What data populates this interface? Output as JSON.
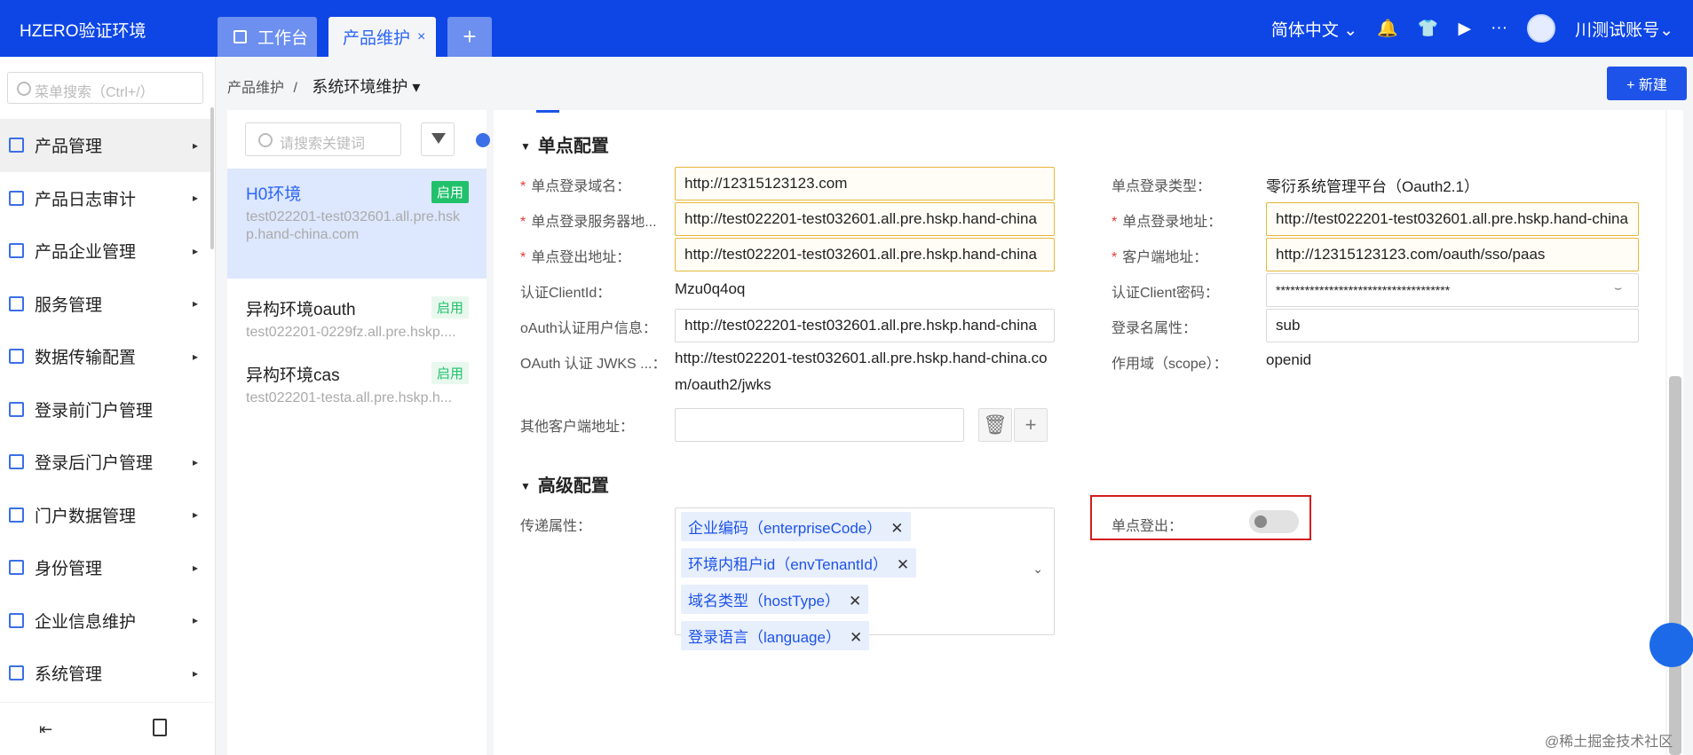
{
  "app": {
    "brand": "HZERO验证环境"
  },
  "tabs": {
    "workspace": "工作台",
    "product": "产品维护",
    "close": "×",
    "add": "+"
  },
  "topbar": {
    "language": "简体中文 ⌄",
    "user": "川测试账号⌄"
  },
  "sidebar": {
    "search_placeholder": "菜单搜索（Ctrl+/）",
    "items": [
      {
        "label": "产品管理",
        "arrow": "▸"
      },
      {
        "label": "产品日志审计",
        "arrow": "▸"
      },
      {
        "label": "产品企业管理",
        "arrow": "▸"
      },
      {
        "label": "服务管理",
        "arrow": "▸"
      },
      {
        "label": "数据传输配置",
        "arrow": "▸"
      },
      {
        "label": "登录前门户管理",
        "arrow": ""
      },
      {
        "label": "登录后门户管理",
        "arrow": "▸"
      },
      {
        "label": "门户数据管理",
        "arrow": "▸"
      },
      {
        "label": "身份管理",
        "arrow": "▸"
      },
      {
        "label": "企业信息维护",
        "arrow": "▸"
      },
      {
        "label": "系统管理",
        "arrow": "▸"
      }
    ],
    "footer_collapse": "⇤"
  },
  "breadcrumb": {
    "parent": "产品维护",
    "sep": "/",
    "current": "系统环境维护 ▾"
  },
  "new_button": "+ 新建",
  "list": {
    "search_placeholder": "请搜索关键词",
    "items": [
      {
        "name": "H0环境",
        "sub": "test022201-test032601.all.pre.hskp.hand-china.com",
        "badge": "启用"
      },
      {
        "name": "异构环境oauth",
        "sub": "test022201-0229fz.all.pre.hskp....",
        "badge": "启用"
      },
      {
        "name": "异构环境cas",
        "sub": "test022201-testa.all.pre.hskp.h...",
        "badge": "启用"
      }
    ]
  },
  "sso": {
    "section": "单点配置",
    "domain_label": "单点登录域名：",
    "domain_value": "http://12315123123.com",
    "type_label": "单点登录类型：",
    "type_value": "零衍系统管理平台（Oauth2.1）",
    "server_label": "单点登录服务器地...",
    "server_value": "http://test022201-test032601.all.pre.hskp.hand-china",
    "login_url_label": "单点登录地址：",
    "login_url_value": "http://test022201-test032601.all.pre.hskp.hand-china",
    "logout_url_label": "单点登出地址：",
    "logout_url_value": "http://test022201-test032601.all.pre.hskp.hand-china",
    "client_url_label": "客户端地址：",
    "client_url_value": "http://12315123123.com/oauth/sso/paas",
    "client_id_label": "认证ClientId：",
    "client_id_value": "Mzu0q4oq",
    "client_secret_label": "认证Client密码：",
    "client_secret_value": "************************************",
    "userinfo_label": "oAuth认证用户信息：",
    "userinfo_value": "http://test022201-test032601.all.pre.hskp.hand-china",
    "login_attr_label": "登录名属性：",
    "login_attr_value": "sub",
    "jwks_label": "OAuth 认证 JWKS ...：",
    "jwks_value": "http://test022201-test032601.all.pre.hskp.hand-china.com/oauth2/jwks",
    "scope_label": "作用域（scope）：",
    "scope_value": "openid",
    "other_client_label": "其他客户端地址："
  },
  "advanced": {
    "section": "高级配置",
    "attrs_label": "传递属性：",
    "tags": [
      "企业编码（enterpriseCode）",
      "环境内租户id（envTenantId）",
      "域名类型（hostType）",
      "登录语言（language）"
    ],
    "sso_logout_label": "单点登出："
  },
  "watermark": "@稀土掘金技术社区"
}
